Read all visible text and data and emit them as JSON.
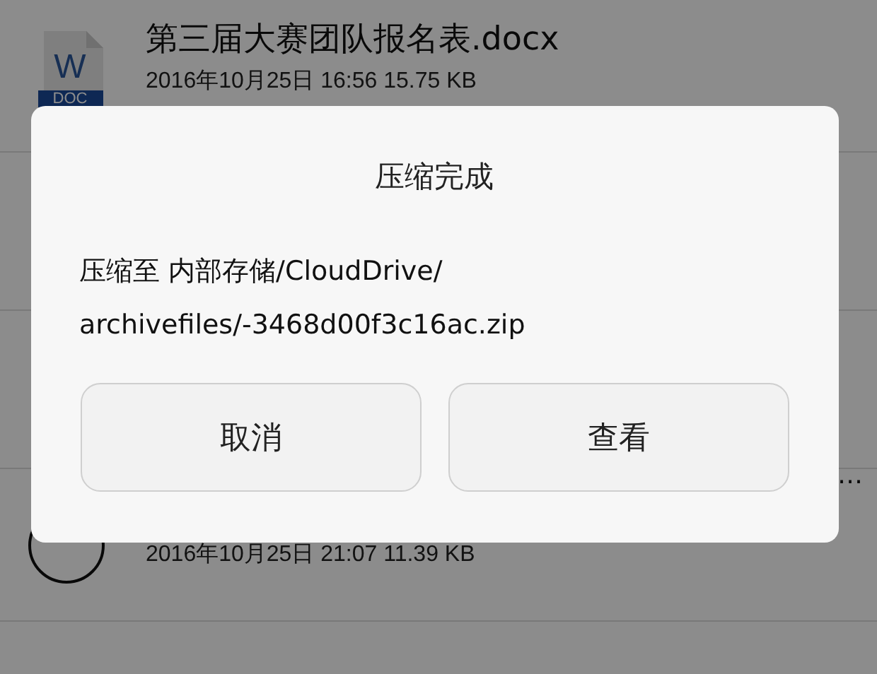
{
  "files": [
    {
      "kind": "doc",
      "icon_letter": "W",
      "icon_badge": "DOC",
      "title": "第三届大赛团队报名表.docx",
      "meta": "2016年10月25日 16:56 15.75 KB"
    },
    {
      "kind": "avatar",
      "title": "…",
      "meta": "2016年10月25日 21:07 11.39 KB"
    }
  ],
  "dialog": {
    "title": "压缩完成",
    "message": "压缩至 内部存储/CloudDrive/ archivefiles/-3468d00f3c16ac.zip",
    "buttons": [
      "取消",
      "查看"
    ]
  }
}
